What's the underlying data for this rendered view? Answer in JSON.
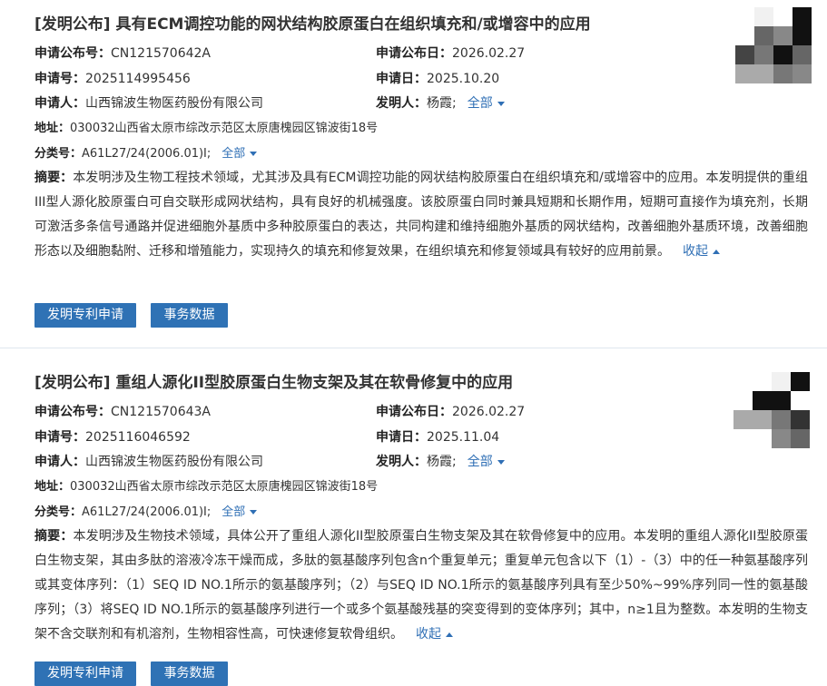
{
  "records": [
    {
      "title": "[发明公布] 具有ECM调控功能的网状结构胶原蛋白在组织填充和/或增容中的应用",
      "pub_no_label": "申请公布号：",
      "pub_no": "CN121570642A",
      "pub_date_label": "申请公布日：",
      "pub_date": "2026.02.27",
      "app_no_label": "申请号：",
      "app_no": "2025114995456",
      "app_date_label": "申请日：",
      "app_date": "2025.10.20",
      "applicant_label": "申请人：",
      "applicant": "山西锦波生物医药股份有限公司",
      "inventor_label": "发明人：",
      "inventor": "杨霞;",
      "inventor_all": "全部",
      "address_label": "地址：",
      "address": "030032山西省太原市综改示范区太原唐槐园区锦波街18号",
      "class_label": "分类号：",
      "class": "A61L27/24(2006.01)I;",
      "class_all": "全部",
      "abstract_label": "摘要：",
      "abstract": "本发明涉及生物工程技术领域，尤其涉及具有ECM调控功能的网状结构胶原蛋白在组织填充和/或增容中的应用。本发明提供的重组III型人源化胶原蛋白可自交联形成网状结构，具有良好的机械强度。该胶原蛋白同时兼具短期和长期作用，短期可直接作为填充剂，长期可激活多条信号通路并促进细胞外基质中多种胶原蛋白的表达，共同构建和维持细胞外基质的网状结构，改善细胞外基质环境，改善细胞形态以及细胞黏附、迁移和增殖能力，实现持久的填充和修复效果，在组织填充和修复领域具有较好的应用前景。",
      "collapse": "收起",
      "btn_apply": "发明专利申请",
      "btn_affairs": "事务数据"
    },
    {
      "title": "[发明公布] 重组人源化II型胶原蛋白生物支架及其在软骨修复中的应用",
      "pub_no_label": "申请公布号：",
      "pub_no": "CN121570643A",
      "pub_date_label": "申请公布日：",
      "pub_date": "2026.02.27",
      "app_no_label": "申请号：",
      "app_no": "2025116046592",
      "app_date_label": "申请日：",
      "app_date": "2025.11.04",
      "applicant_label": "申请人：",
      "applicant": "山西锦波生物医药股份有限公司",
      "inventor_label": "发明人：",
      "inventor": "杨霞;",
      "inventor_all": "全部",
      "address_label": "地址：",
      "address": "030032山西省太原市综改示范区太原唐槐园区锦波街18号",
      "class_label": "分类号：",
      "class": "A61L27/24(2006.01)I;",
      "class_all": "全部",
      "abstract_label": "摘要：",
      "abstract": "本发明涉及生物技术领域，具体公开了重组人源化II型胶原蛋白生物支架及其在软骨修复中的应用。本发明的重组人源化II型胶原蛋白生物支架，其由多肽的溶液冷冻干燥而成，多肽的氨基酸序列包含n个重复单元；重复单元包含以下（1）-（3）中的任一种氨基酸序列或其变体序列：（1）SEQ ID NO.1所示的氨基酸序列；（2）与SEQ ID NO.1所示的氨基酸序列具有至少50%~99%序列同一性的氨基酸序列；（3）将SEQ ID NO.1所示的氨基酸序列进行一个或多个氨基酸残基的突变得到的变体序列；其中，n≥1且为整数。本发明的生物支架不含交联剂和有机溶剂，生物相容性高，可快速修复软骨组织。",
      "collapse": "收起",
      "btn_apply": "发明专利申请",
      "btn_affairs": "事务数据"
    }
  ]
}
